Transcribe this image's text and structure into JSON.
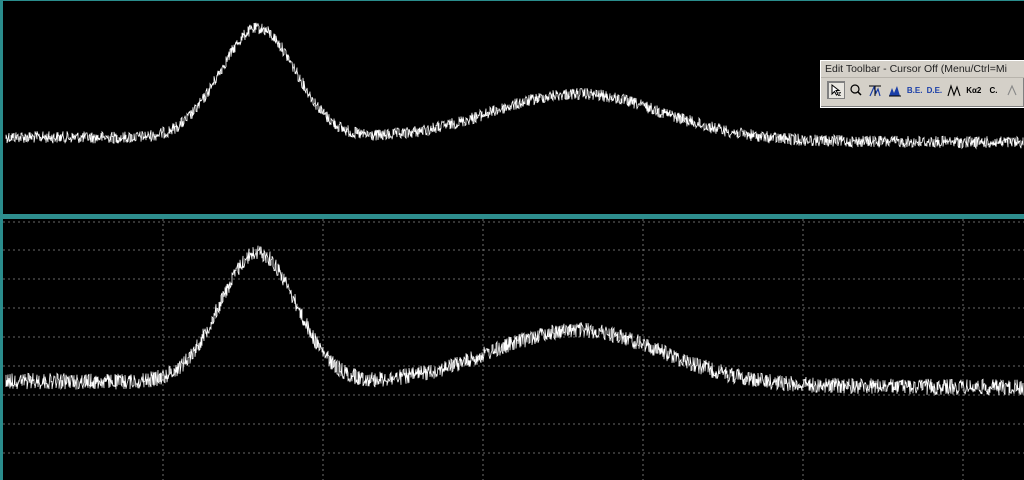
{
  "window": {
    "background": "#000000",
    "accent": "#2e8e8e",
    "trace_color": "#ffffff",
    "grid_color": "#8a8a8a"
  },
  "top_plot": {
    "grid": false
  },
  "bottom_plot": {
    "grid": true
  },
  "toolbar": {
    "title": "Edit Toolbar - Cursor Off (Menu/Ctrl=Mi",
    "buttons": [
      {
        "name": "select-cursor-icon",
        "label": "",
        "active": true
      },
      {
        "name": "zoom-icon",
        "label": ""
      },
      {
        "name": "peak-marker-icon",
        "label": ""
      },
      {
        "name": "fill-peak-icon",
        "label": ""
      },
      {
        "name": "be-button",
        "label": "B.E."
      },
      {
        "name": "de-button",
        "label": "D.E."
      },
      {
        "name": "multi-peak-icon",
        "label": ""
      },
      {
        "name": "ka2-button",
        "label": "Kα2"
      },
      {
        "name": "c-button",
        "label": "C."
      },
      {
        "name": "more-icon",
        "label": ""
      }
    ]
  }
}
